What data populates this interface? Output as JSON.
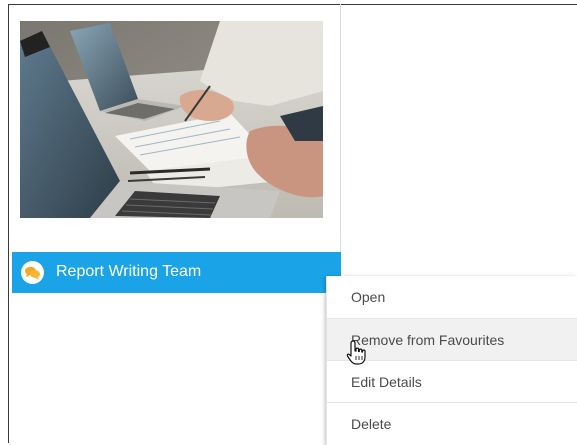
{
  "card": {
    "title": "Report Writing Team",
    "image_alt": "photo-laptops-desk-meeting",
    "badge_icon": "chat-bubbles-icon",
    "accent": "#1aa3e6"
  },
  "context_menu": {
    "items": [
      {
        "label": "Open"
      },
      {
        "label": "Remove from Favourites"
      },
      {
        "label": "Edit Details"
      },
      {
        "label": "Delete"
      }
    ],
    "hovered_item": "Remove from Favourites"
  },
  "cursor": {
    "icon": "hand-pointer-icon"
  }
}
